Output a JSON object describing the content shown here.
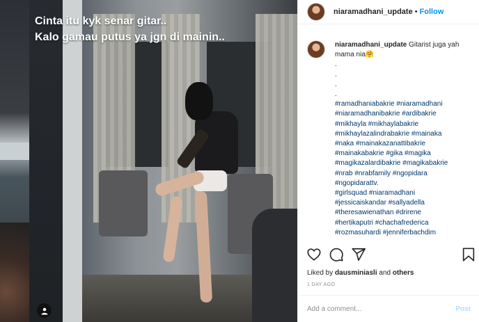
{
  "post": {
    "username": "niaramadhani_update",
    "separator": "•",
    "follow_label": "Follow",
    "video_caption": {
      "line1": "Cinta itu kyk senar gitar..",
      "line2": "Kalo gamau putus ya jgn di mainin.."
    },
    "caption": {
      "username": "niaramadhani_update",
      "text": "Gitarist juga yah mama nia🤗",
      "dots": [
        ".",
        ".",
        ".",
        "."
      ],
      "hashtag_lines": [
        "#ramadhaniabakrie #niaramadhani",
        "#niaramadhanibakrie #ardibakrie",
        "#mikhayla #mikhaylabakrie",
        "#mikhaylazalindrabakrie #mainaka",
        "#naka #mainakazanattibakrie",
        "#mainakabakrie #gika #magika",
        "#magikazalardibakrie #magikabakrie",
        "#nrab #nrabfamily #ngopidara",
        "#ngopidarattv.",
        "#girlsquad #niaramadhani",
        "#jessicaiskandar #sallyadella",
        "#theresawienathan #drirene",
        "#hertikaputri #chachafrederica",
        "#rozmasuhardi #jenniferbachdim"
      ]
    },
    "likes": {
      "prefix": "Liked by",
      "user": "dausminiasli",
      "conj": "and",
      "others": "others"
    },
    "time_ago": "1 DAY AGO",
    "comment_placeholder": "Add a comment...",
    "post_label": "Post"
  },
  "colors": {
    "link_blue": "#0095f6",
    "hashtag": "#00376b",
    "muted": "#8e8e8e",
    "post_disabled": "#b2dffc"
  },
  "icons": [
    "heart-icon",
    "comment-icon",
    "share-icon",
    "bookmark-icon",
    "user-tag-icon"
  ]
}
